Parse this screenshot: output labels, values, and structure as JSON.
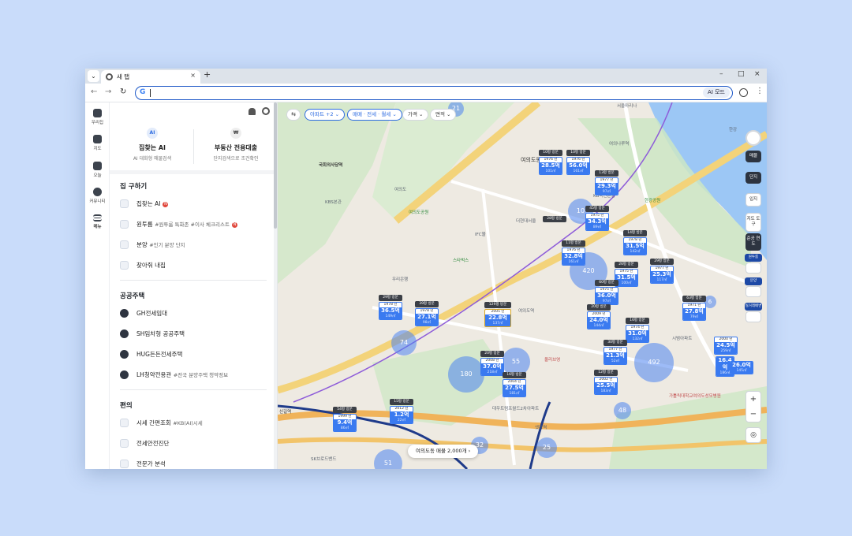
{
  "browser": {
    "tab_title": "새 탭",
    "tab_close": "×",
    "new_tab": "+",
    "menu_chevron": "⌄",
    "win_min": "–",
    "win_max": "□",
    "win_close": "×",
    "back": "←",
    "forward": "→",
    "reload": "↻",
    "google_g": "G",
    "ai_mode": "AI 모드",
    "kebab": "⋮"
  },
  "rail": [
    {
      "label": "우리집"
    },
    {
      "label": "지도"
    },
    {
      "label": "오늘"
    },
    {
      "label": "커뮤니티"
    },
    {
      "label": "메뉴"
    }
  ],
  "panel": {
    "features": [
      {
        "icon": "AI",
        "title": "집찾는 AI",
        "subtitle": "AI 대화형 매물검색"
      },
      {
        "icon": "₩",
        "title": "부동산 전용대출",
        "subtitle": "단지검색으로 조건확인"
      }
    ],
    "sections": [
      {
        "title": "집 구하기",
        "items": [
          {
            "label": "집찾는 AI",
            "tag": "",
            "badge": "N"
          },
          {
            "label": "원투룸",
            "tag": "#원투룸 특화존 #이사 체크리스트",
            "badge": "N"
          },
          {
            "label": "분양",
            "tag": "#인기 분양 단지",
            "badge": ""
          },
          {
            "label": "찾아줘 내집",
            "tag": "",
            "badge": ""
          }
        ]
      },
      {
        "title": "공공주택",
        "items": [
          {
            "label": "GH전세임대",
            "tag": "",
            "badge": ""
          },
          {
            "label": "SH임차형 공공주택",
            "tag": "",
            "badge": ""
          },
          {
            "label": "HUG든든전세주택",
            "tag": "",
            "badge": ""
          },
          {
            "label": "LH청약전용관",
            "tag": "#전국 분양주택 청약정보",
            "badge": ""
          }
        ]
      },
      {
        "title": "편의",
        "items": [
          {
            "label": "시세 간편조회",
            "tag": "#KB(AI)시세",
            "badge": ""
          },
          {
            "label": "전세안전진단",
            "tag": "",
            "badge": ""
          },
          {
            "label": "전문가 분석",
            "tag": "",
            "badge": ""
          }
        ]
      }
    ]
  },
  "map": {
    "filter_toggle": "⇆",
    "chips": [
      {
        "label": "아파트 +2 ⌄",
        "active": true
      },
      {
        "label": "매매 · 전세 · 월세 ⌄",
        "active": true
      },
      {
        "label": "가격 ⌄",
        "active": false
      },
      {
        "label": "면적 ⌄",
        "active": false
      }
    ],
    "tools": {
      "sale": "매물",
      "complex": "단지",
      "land": "입지",
      "map_tool": "지도 도구",
      "year_built": "준공 연도",
      "badge1": "원투룸",
      "badge2": "분양",
      "badge3": "실거래배변",
      "zoom_in": "+",
      "zoom_out": "−",
      "locate": "◎"
    },
    "listing_pill": "여의도동 매물 2,000개 ›",
    "clusters": [
      "21",
      "10",
      "420",
      "74",
      "180",
      "55",
      "492",
      "48",
      "51",
      "32",
      "25",
      "6"
    ],
    "markers": [
      {
        "tag": "10평 방문",
        "year": "1976 년",
        "price": "28.5억",
        "area": "101㎡"
      },
      {
        "tag": "10평 방문",
        "year": "1976 년",
        "price": "56.0억",
        "area": "161㎡"
      },
      {
        "tag": "13평 방문",
        "year": "1977 년",
        "price": "29.3억",
        "area": "97㎡"
      },
      {
        "tag": "45평 방문",
        "year": "1975 년",
        "price": "34.3억",
        "area": "89㎡"
      },
      {
        "tag": "28평 방문",
        "year": "",
        "price": "",
        "area": ""
      },
      {
        "tag": "14평 방문",
        "year": "1978 년",
        "price": "31.5억",
        "area": "142㎡"
      },
      {
        "tag": "11평 방문",
        "year": "1976 년",
        "price": "32.8억",
        "area": "161㎡"
      },
      {
        "tag": "26평 방문",
        "year": "1975 년",
        "price": "31.5억",
        "area": "100㎡"
      },
      {
        "tag": "29평 방문",
        "year": "1977 년",
        "price": "25.3억",
        "area": "117㎡"
      },
      {
        "tag": "29평 방문",
        "year": "1978 년",
        "price": "36.5억",
        "area": "149㎡"
      },
      {
        "tag": "39평 방문",
        "year": "1978 년",
        "price": "27.1억",
        "area": "98㎡"
      },
      {
        "tag": "129평 방문",
        "year": "2005 년",
        "price": "22.8억",
        "area": "137㎡"
      },
      {
        "tag": "60평 방문",
        "year": "1975 년",
        "price": "36.0억",
        "area": "97㎡"
      },
      {
        "tag": "63평 방문",
        "year": "1971 년",
        "price": "27.8억",
        "area": "79㎡"
      },
      {
        "tag": "20평 방문",
        "year": "2009 년",
        "price": "24.0억",
        "area": "144㎡"
      },
      {
        "tag": "16평 방문",
        "year": "1974 년",
        "price": "31.0억",
        "area": "132㎡"
      },
      {
        "tag": "",
        "year": "2000 년",
        "price": "24.5억",
        "area": "259㎡"
      },
      {
        "tag": "",
        "year": "",
        "price": "16.4억",
        "area": "186㎡"
      },
      {
        "tag": "",
        "year": "",
        "price": "26.0억",
        "area": "145㎡"
      },
      {
        "tag": "20평 방문",
        "year": "2008 년",
        "price": "37.0억",
        "area": "218㎡"
      },
      {
        "tag": "16평 방문",
        "year": "2004 년",
        "price": "27.5억",
        "area": "181㎡"
      },
      {
        "tag": "30평 방문",
        "year": "1977 년",
        "price": "21.3억",
        "area": "52㎡"
      },
      {
        "tag": "12평 방문",
        "year": "2002 년",
        "price": "25.5억",
        "area": "183㎡"
      },
      {
        "tag": "15평 방문",
        "year": "2012 년",
        "price": "1.2억",
        "area": "22㎡"
      },
      {
        "tag": "54평 방문",
        "year": "1999 년",
        "price": "9.4억",
        "area": "86㎡"
      }
    ],
    "labels": [
      "국회의사당역",
      "여의도",
      "여의도동",
      "더현대서울",
      "IFC몰",
      "여의도공원",
      "한강",
      "여의나루역",
      "여의도역",
      "샛강역",
      "신길역",
      "우리은행",
      "스타벅스",
      "KBS본관",
      "서울마리나",
      "한강공원",
      "올리브영",
      "대우트럼프월드2차아파트",
      "시범아파트",
      "가톨릭대학교여의도성모병원",
      "SK브로드밴드",
      "KB국민은행"
    ]
  }
}
